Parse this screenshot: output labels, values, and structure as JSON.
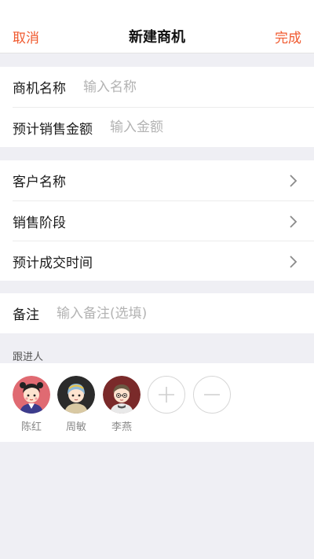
{
  "nav": {
    "cancel_label": "取消",
    "title": "新建商机",
    "done_label": "完成"
  },
  "form": {
    "opportunity_name": {
      "label": "商机名称",
      "placeholder": "输入名称"
    },
    "expected_amount": {
      "label": "预计销售金额",
      "placeholder": "输入金额"
    },
    "customer_name": {
      "label": "客户名称"
    },
    "sales_stage": {
      "label": "销售阶段"
    },
    "expected_close_time": {
      "label": "预计成交时间"
    },
    "remarks": {
      "label": "备注",
      "placeholder": "输入备注(选填)"
    }
  },
  "followers": {
    "title": "跟进人",
    "people": [
      {
        "name": "陈红"
      },
      {
        "name": "周敏"
      },
      {
        "name": "李燕"
      }
    ]
  },
  "colors": {
    "accent": "#f0592e",
    "background": "#efeff4"
  }
}
